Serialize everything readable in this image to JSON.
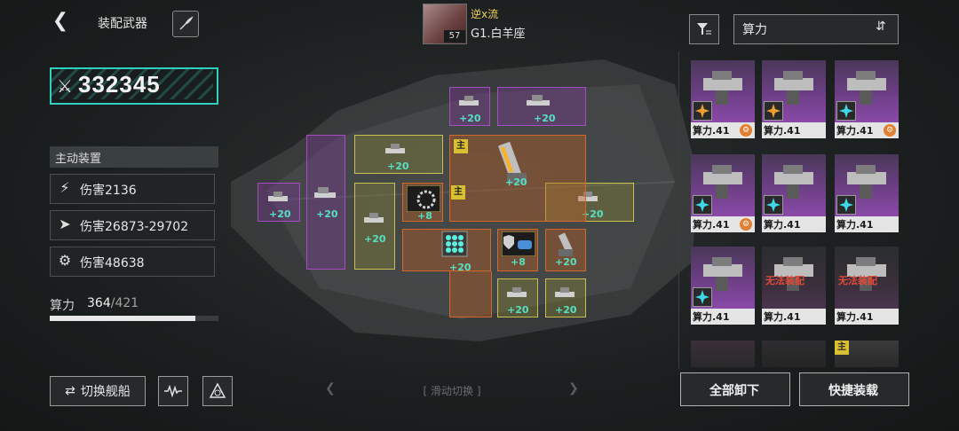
{
  "header": {
    "title": "装配武器",
    "pilot": {
      "name": "逆x流",
      "level": "57"
    },
    "ship_name": "G1.白羊座"
  },
  "power": {
    "value": "332345"
  },
  "active_devices": {
    "title": "主动装置",
    "items": [
      {
        "icon": "slash-icon",
        "label": "伤害2136"
      },
      {
        "icon": "missile-icon",
        "label": "伤害26873-29702"
      },
      {
        "icon": "gear-ring-icon",
        "label": "伤害48638"
      }
    ]
  },
  "capacity": {
    "label": "算力",
    "used": "364",
    "max": "/421",
    "fraction": 0.865
  },
  "bottom": {
    "switch_ship": "切换舰船",
    "swipe_hint": "滑动切换"
  },
  "slots": [
    {
      "color": "purple",
      "value": "+20",
      "main": false
    },
    {
      "color": "purple",
      "value": "+20",
      "main": false
    },
    {
      "color": "purple",
      "value": "+20",
      "main": false
    },
    {
      "color": "purple",
      "value": "+20",
      "main": false
    },
    {
      "color": "yellow",
      "value": "+20",
      "main": false
    },
    {
      "color": "yellow",
      "value": "+20",
      "main": false
    },
    {
      "color": "yellow",
      "value": "+20",
      "main": false
    },
    {
      "color": "yellow",
      "value": "+20",
      "main": false
    },
    {
      "color": "yellow",
      "value": "+20",
      "main": false
    },
    {
      "color": "orange",
      "value": "+20",
      "main": true
    },
    {
      "color": "orange",
      "value": "+8",
      "main": true
    },
    {
      "color": "orange",
      "value": "+20",
      "main": false
    },
    {
      "color": "orange",
      "value": "+8",
      "main": false
    },
    {
      "color": "orange",
      "value": "+20",
      "main": false
    }
  ],
  "main_tag": "主",
  "inventory": {
    "sort_label": "算力",
    "cards": [
      {
        "label": "算力.41",
        "style": "purple",
        "warning": ""
      },
      {
        "label": "算力.41",
        "style": "purple",
        "warning": ""
      },
      {
        "label": "算力.41",
        "style": "purple",
        "warning": ""
      },
      {
        "label": "算力.41",
        "style": "purple",
        "warning": ""
      },
      {
        "label": "算力.41",
        "style": "purple",
        "warning": ""
      },
      {
        "label": "算力.41",
        "style": "purple",
        "warning": ""
      },
      {
        "label": "算力.41",
        "style": "purple",
        "warning": ""
      },
      {
        "label": "算力.41",
        "style": "dark",
        "warning": "无法装配"
      },
      {
        "label": "算力.41",
        "style": "dark",
        "warning": "无法装配"
      }
    ],
    "unload_all": "全部卸下",
    "quick_equip": "快捷装载"
  }
}
